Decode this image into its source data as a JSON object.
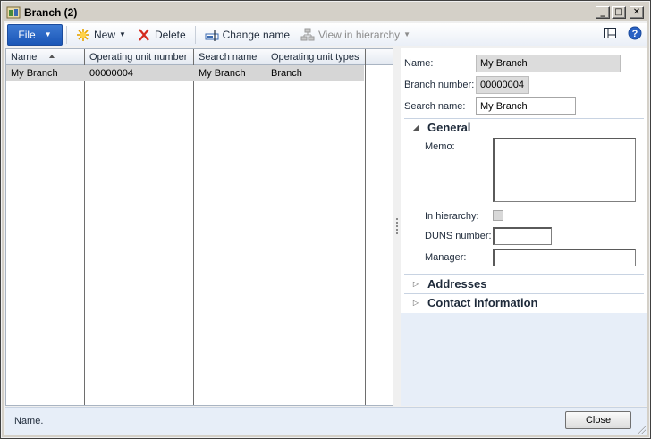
{
  "window": {
    "title": "Branch (2)"
  },
  "ribbon": {
    "file_label": "File",
    "new_label": "New",
    "delete_label": "Delete",
    "change_name_label": "Change name",
    "view_hierarchy_label": "View in hierarchy"
  },
  "grid": {
    "columns": [
      "Name",
      "Operating unit number",
      "Search name",
      "Operating unit types"
    ],
    "rows": [
      [
        "My Branch",
        "00000004",
        "My Branch",
        "Branch"
      ]
    ]
  },
  "details": {
    "name_label": "Name:",
    "name_value": "My Branch",
    "branch_number_label": "Branch number:",
    "branch_number_value": "00000004",
    "search_name_label": "Search name:",
    "search_name_value": "My Branch",
    "general_title": "General",
    "memo_label": "Memo:",
    "in_hierarchy_label": "In hierarchy:",
    "duns_label": "DUNS number:",
    "manager_label": "Manager:",
    "addresses_title": "Addresses",
    "contact_title": "Contact information"
  },
  "status": {
    "text": "Name.",
    "close_label": "Close"
  },
  "colors": {
    "accent": "#1a56b7",
    "selected_row": "#d6d6d6",
    "pane_bg": "#e7eef8"
  }
}
